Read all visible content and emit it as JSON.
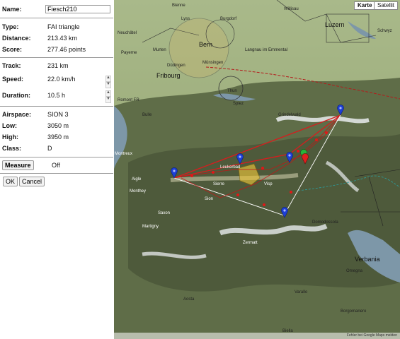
{
  "panel": {
    "name_label": "Name:",
    "name_value": "Fiesch210",
    "type_label": "Type:",
    "type_value": "FAI triangle",
    "distance_label": "Distance:",
    "distance_value": "213.43 km",
    "score_label": "Score:",
    "score_value": "277.46 points",
    "track_label": "Track:",
    "track_value": "231 km",
    "speed_label": "Speed:",
    "speed_value": "22.0 km/h",
    "duration_label": "Duration:",
    "duration_value": "10.5 h",
    "airspace_label": "Airspace:",
    "airspace_value": "SION 3",
    "low_label": "Low:",
    "low_value": "3050 m",
    "high_label": "High:",
    "high_value": "3950 m",
    "class_label": "Class:",
    "class_value": "D",
    "measure_label": "Measure",
    "measure_value": "Off",
    "ok_label": "OK",
    "cancel_label": "Cancel",
    "spin_up": "▲",
    "spin_down": "▼"
  },
  "map": {
    "map_button": "Karte",
    "satellite_button": "Satellit",
    "footer": "Fehler bei Google Maps melden",
    "towns": {
      "biel": "Bienne",
      "lyss": "Lyss",
      "burgdorf": "Burgdorf",
      "willisau": "Willisau",
      "luzern": "Luzern",
      "neuchatel": "Neuchâtel",
      "bern": "Bern",
      "munsingen": "Münsingen",
      "langnau": "Langnau im Emmental",
      "murten": "Murten",
      "payerne": "Payerne",
      "fribourg": "Fribourg",
      "dudingen": "Düdingen",
      "thun": "Thun",
      "spiez": "Spiez",
      "bulle": "Bulle",
      "romont": "Romont FR",
      "grindelwald": "Grindelwald",
      "montreux": "Montreux",
      "aigle": "Aigle",
      "sierre": "Sierre",
      "sion": "Sion",
      "visp": "Visp",
      "monthey": "Monthey",
      "martigny": "Martigny",
      "saxon": "Saxon",
      "zermatt": "Zermatt",
      "domodossola": "Domodossola",
      "verbania": "Verbania",
      "aosta": "Aosta",
      "biella": "Biella",
      "borgomanero": "Borgomanero",
      "omegna": "Omegna",
      "varallo": "Varallo",
      "leukerbad": "Leukerbad",
      "schwyz": "Schwyz"
    }
  }
}
